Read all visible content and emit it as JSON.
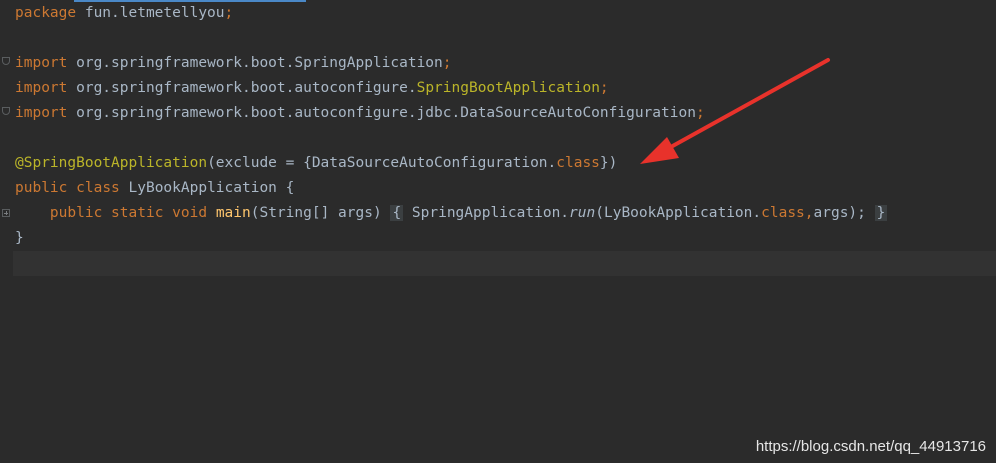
{
  "editor": {
    "lines": {
      "l1": {
        "kw": "package",
        "rest": " fun.letmetellyou",
        "semi": ";"
      },
      "l3": {
        "kw": "import",
        "rest": " org.springframework.boot.SpringApplication",
        "semi": ";"
      },
      "l4": {
        "kw": "import",
        "pre": " org.springframework.boot.autoconfigure.",
        "ann": "SpringBootApplication",
        "semi": ";"
      },
      "l5": {
        "kw": "import",
        "rest": " org.springframework.boot.autoconfigure.jdbc.DataSourceAutoConfiguration",
        "semi": ";"
      },
      "l7": {
        "ann": "@SpringBootApplication",
        "pre": "(exclude = {DataSourceAutoConfiguration.",
        "kw": "class",
        "post": "})"
      },
      "l8": {
        "kw1": "public",
        "kw2": "class",
        "rest": " LyBookApplication {"
      },
      "l9": {
        "indent": "    ",
        "kw1": "public",
        "kw2": "static",
        "kw3": "void",
        "fn": "main",
        "params": "(String[] args) ",
        "fold_open": "{",
        "body1": " SpringApplication.",
        "run": "run",
        "body2": "(LyBookApplication.",
        "kw_class": "class",
        "comma": ",",
        "args": "args);",
        "fold_close": "}"
      },
      "l10": {
        "text": "}"
      }
    }
  },
  "watermark": "https://blog.csdn.net/qq_44913716",
  "colors": {
    "background": "#2b2b2b",
    "keyword": "#cc7832",
    "annotation": "#bbb529",
    "text": "#a9b7c6",
    "arrow": "#e8322b"
  }
}
